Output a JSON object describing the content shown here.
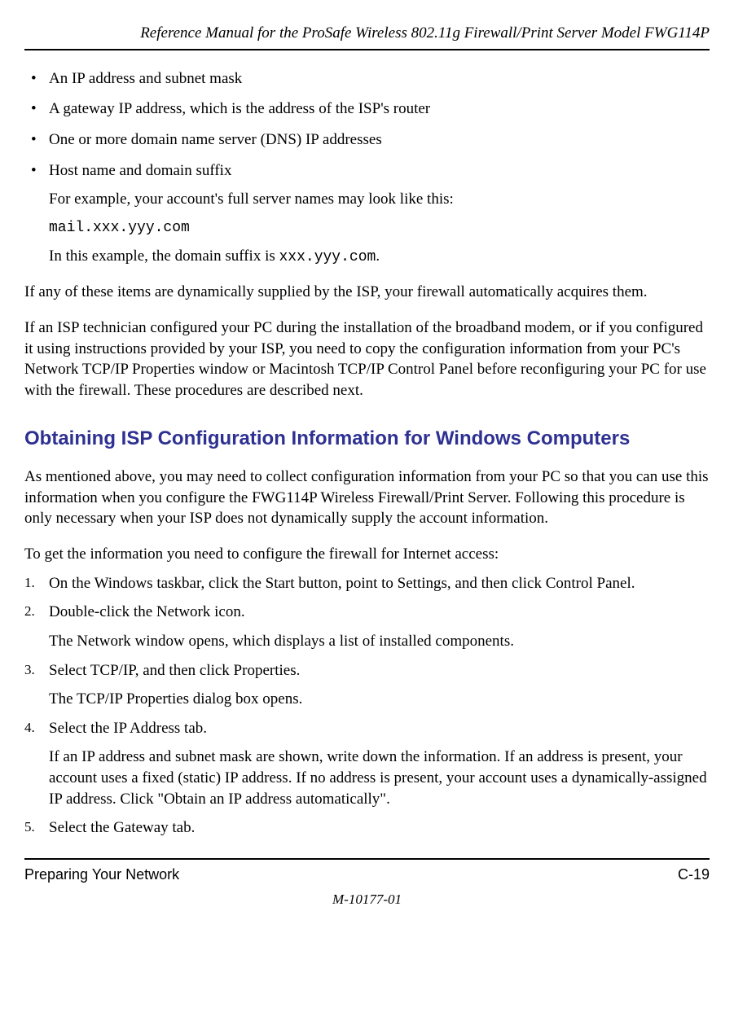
{
  "header": {
    "title": "Reference Manual for the ProSafe Wireless 802.11g  Firewall/Print Server Model FWG114P"
  },
  "bullets": {
    "b1": "An IP address and subnet mask",
    "b2": "A gateway IP address, which is the address of the ISP's router",
    "b3": "One or more domain name server (DNS) IP addresses",
    "b4": "Host name and domain suffix",
    "b4_sub1": "For example, your account's full server names may look like this:",
    "b4_code": "mail.xxx.yyy.com",
    "b4_sub2_a": "In this example, the domain suffix is ",
    "b4_sub2_code": "xxx.yyy.com",
    "b4_sub2_b": "."
  },
  "paragraphs": {
    "p1": "If any of these items are dynamically supplied by the ISP, your firewall automatically acquires them.",
    "p2": "If an ISP technician configured your PC during the installation of the broadband modem, or if you configured it using instructions provided by your ISP, you need to copy the configuration information from your PC's Network TCP/IP Properties window or Macintosh TCP/IP Control Panel before reconfiguring your PC for use with the firewall. These procedures are described next."
  },
  "section": {
    "heading": "Obtaining ISP Configuration Information for Windows Computers",
    "intro": "As mentioned above, you may need to collect configuration information from your PC so that you can use this information when you configure the FWG114P Wireless Firewall/Print Server. Following this procedure is only necessary when your ISP does not dynamically supply the account information.",
    "lead": "To get the information you need to configure the firewall for Internet access:"
  },
  "steps": {
    "s1": "On the Windows taskbar, click the Start button, point to Settings, and then click Control Panel.",
    "s2": "Double-click the Network icon.",
    "s2_sub": "The Network window opens, which displays a list of installed components.",
    "s3": "Select TCP/IP, and then click Properties.",
    "s3_sub": "The TCP/IP Properties dialog box opens.",
    "s4": "Select the IP Address tab.",
    "s4_sub": "If an IP address and subnet mask are shown, write down the information. If an address is present, your account uses a fixed (static) IP address. If no address is present, your account uses a dynamically-assigned IP address. Click \"Obtain an IP address automatically\".",
    "s5": "Select the Gateway tab."
  },
  "footer": {
    "section": "Preparing Your Network",
    "page": "C-19",
    "docnum": "M-10177-01"
  }
}
